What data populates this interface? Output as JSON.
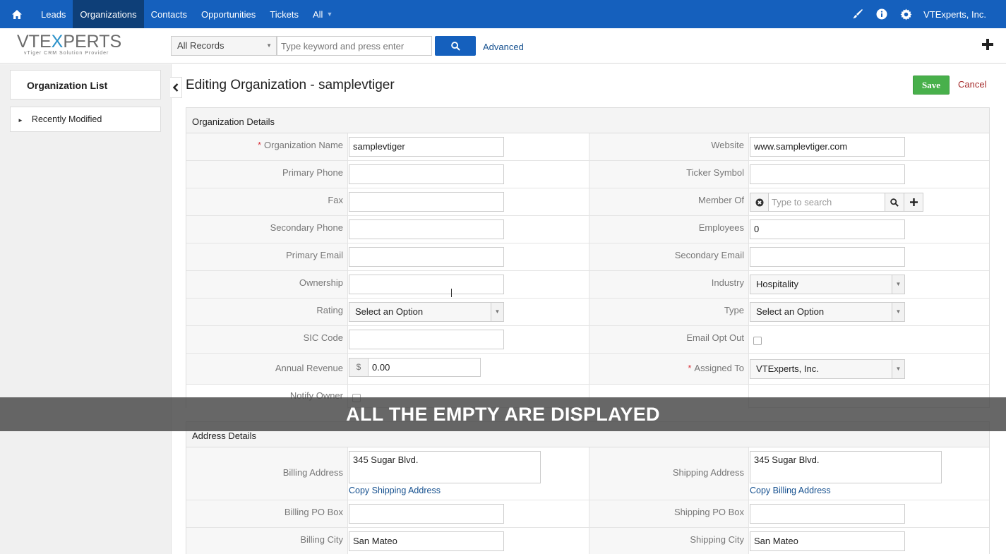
{
  "nav": {
    "items": [
      {
        "label": "Leads",
        "active": false
      },
      {
        "label": "Organizations",
        "active": true
      },
      {
        "label": "Contacts",
        "active": false
      },
      {
        "label": "Opportunities",
        "active": false
      },
      {
        "label": "Tickets",
        "active": false
      },
      {
        "label": "All",
        "active": false
      }
    ],
    "user": "VTExperts, Inc.",
    "icons": [
      "home-icon",
      "brush-icon",
      "info-icon",
      "gear-icon"
    ],
    "color": "#1560bd"
  },
  "subbar": {
    "logo_main": "VTEXPERTS",
    "logo_sub": "vTiger CRM Solution Provider",
    "records_select": "All Records",
    "search_placeholder": "Type keyword and press enter",
    "advanced": "Advanced"
  },
  "sidebar": {
    "title": "Organization List",
    "item": "Recently Modified"
  },
  "header": {
    "title": "Editing Organization - samplevtiger",
    "save": "Save",
    "cancel": "Cancel"
  },
  "org_details": {
    "heading": "Organization Details",
    "org_name_label": "Organization Name",
    "org_name": "samplevtiger",
    "website_label": "Website",
    "website": "www.samplevtiger.com",
    "primary_phone_label": "Primary Phone",
    "ticker_label": "Ticker Symbol",
    "fax_label": "Fax",
    "member_of_label": "Member Of",
    "member_of_placeholder": "Type to search",
    "secondary_phone_label": "Secondary Phone",
    "employees_label": "Employees",
    "employees": "0",
    "primary_email_label": "Primary Email",
    "secondary_email_label": "Secondary Email",
    "ownership_label": "Ownership",
    "industry_label": "Industry",
    "industry": "Hospitality",
    "rating_label": "Rating",
    "rating": "Select an Option",
    "type_label": "Type",
    "type": "Select an Option",
    "sic_label": "SIC Code",
    "email_opt_out_label": "Email Opt Out",
    "revenue_label": "Annual Revenue",
    "currency": "$",
    "revenue": "0.00",
    "assigned_label": "Assigned To",
    "assigned": "VTExperts, Inc.",
    "notify_label": "Notify Owner"
  },
  "address": {
    "heading": "Address Details",
    "billing_address_label": "Billing Address",
    "billing_address": "345 Sugar Blvd.",
    "copy_shipping": "Copy Shipping Address",
    "shipping_address_label": "Shipping Address",
    "shipping_address": "345 Sugar Blvd.",
    "copy_billing": "Copy Billing Address",
    "billing_po_label": "Billing PO Box",
    "shipping_po_label": "Shipping PO Box",
    "billing_city_label": "Billing City",
    "billing_city": "San Mateo",
    "shipping_city_label": "Shipping City",
    "shipping_city": "San Mateo"
  },
  "overlay": "ALL THE EMPTY ARE DISPLAYED"
}
